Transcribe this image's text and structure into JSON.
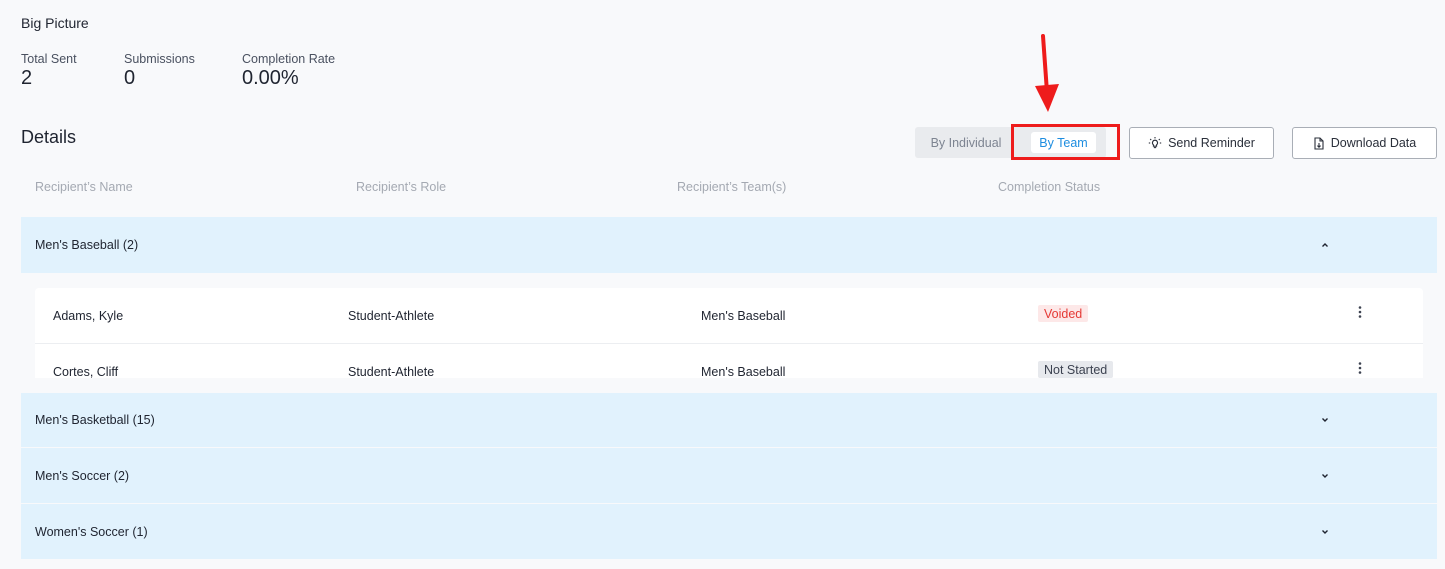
{
  "big_picture": {
    "title": "Big Picture",
    "stats": {
      "total_sent": {
        "label": "Total Sent",
        "value": "2"
      },
      "submissions": {
        "label": "Submissions",
        "value": "0"
      },
      "completion_rate": {
        "label": "Completion Rate",
        "value": "0.00%"
      }
    }
  },
  "details": {
    "title": "Details",
    "view_toggle": {
      "by_individual": "By Individual",
      "by_team": "By Team",
      "selected": "By Team"
    },
    "send_reminder_label": "Send Reminder",
    "download_label": "Download Data",
    "columns": [
      "Recipient’s Name",
      "Recipient’s Role",
      "Recipient’s Team(s)",
      "Completion Status"
    ],
    "groups": [
      {
        "name": "Men's Baseball (2)",
        "expanded": true,
        "rows": [
          {
            "name": "Adams, Kyle",
            "role": "Student-Athlete",
            "team": "Men's Baseball",
            "status": "Voided"
          },
          {
            "name": "Cortes, Cliff",
            "role": "Student-Athlete",
            "team": "Men's Baseball",
            "status": "Not Started"
          }
        ]
      },
      {
        "name": "Men's Basketball (15)",
        "expanded": false
      },
      {
        "name": "Men's Soccer (2)",
        "expanded": false
      },
      {
        "name": "Women's Soccer (1)",
        "expanded": false
      }
    ]
  },
  "colors": {
    "accent_blue": "#1d8de0",
    "group_bg": "#e1f2fd",
    "highlight_red": "#ee1c1c",
    "voided_text": "#e53935",
    "voided_bg": "#fde8e8"
  },
  "icons": {
    "send_reminder": "lightbulb-icon",
    "download": "file-icon",
    "group_expanded": "chevron-up-icon",
    "group_collapsed": "chevron-down-icon",
    "row_menu": "kebab-menu-icon"
  }
}
